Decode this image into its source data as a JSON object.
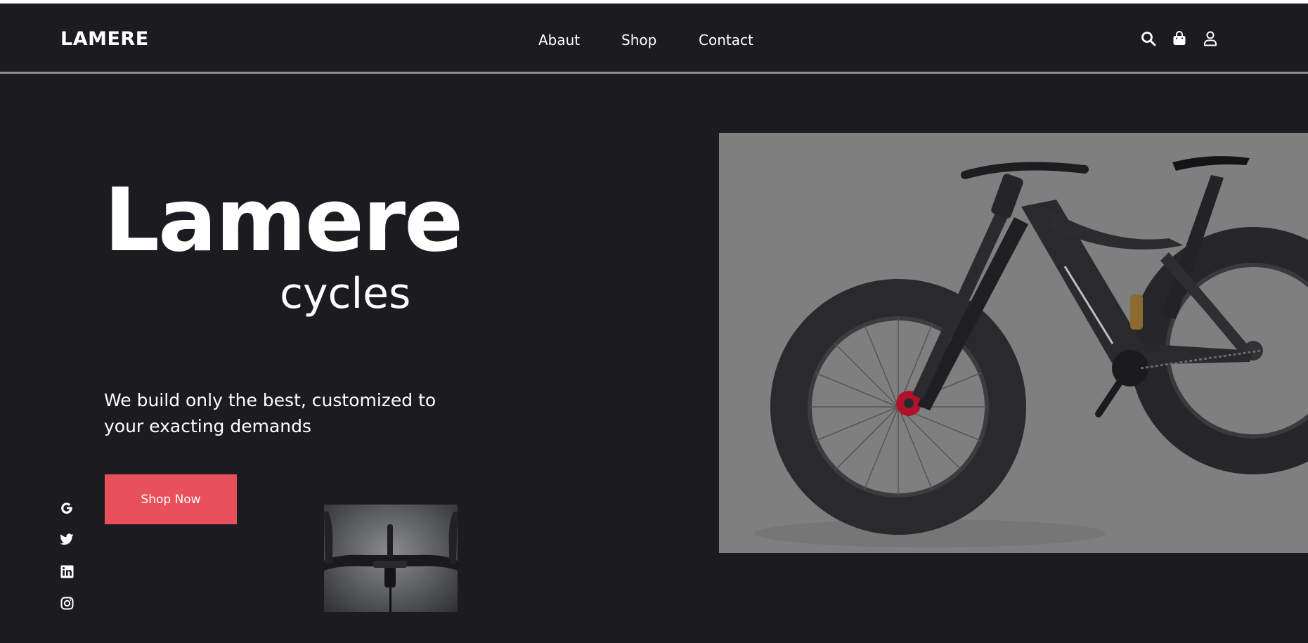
{
  "header": {
    "logo": "LAMERE",
    "nav": [
      {
        "label": "Abaut"
      },
      {
        "label": "Shop"
      },
      {
        "label": "Contact"
      }
    ],
    "icons": [
      "search-icon",
      "shopping-bag-icon",
      "user-icon"
    ]
  },
  "hero": {
    "title": "Lamere",
    "subtitle": "cycles",
    "tagline": "We build only the best, customized to your exacting demands",
    "cta_label": "Shop Now",
    "image": "fat-tire-electric-bike-photo",
    "thumbnail": "handlebar-closeup-photo"
  },
  "socials": [
    "google-icon",
    "twitter-icon",
    "linkedin-icon",
    "instagram-icon"
  ],
  "colors": {
    "background": "#1c1b20",
    "accent": "#e8505b",
    "text": "#ffffff",
    "divider": "#8f8f93",
    "image_background": "#7f7f80"
  }
}
